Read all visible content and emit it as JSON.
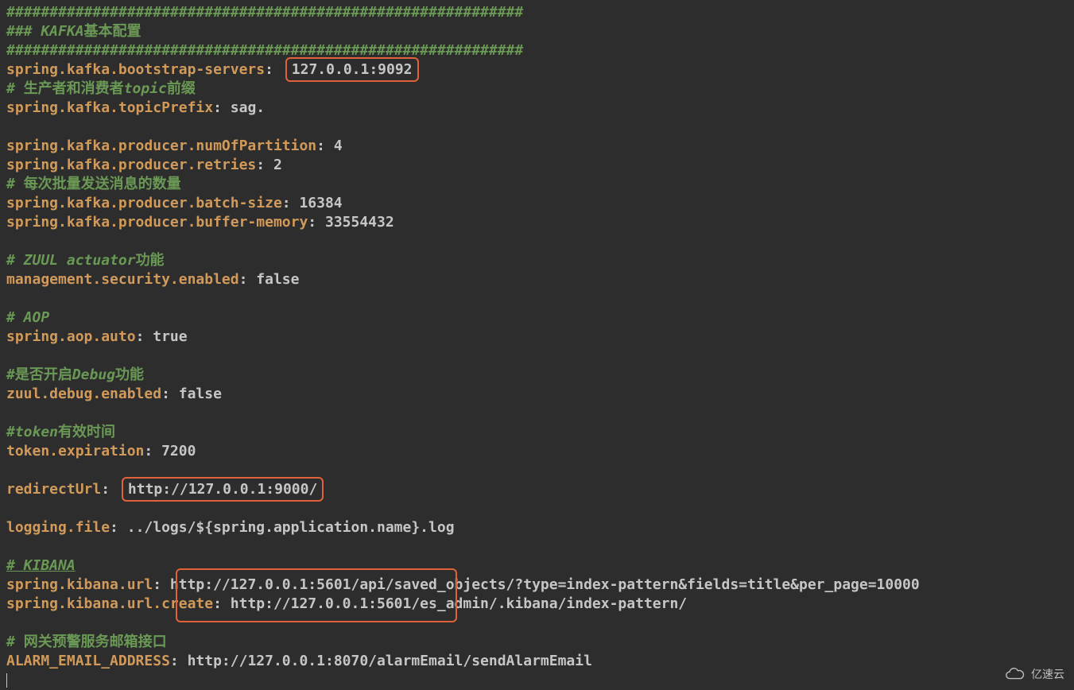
{
  "lines": {
    "l1": "############################################################",
    "l2_a": "### KAFKA",
    "l2_b": "基本配置",
    "l3": "############################################################",
    "k_bootstrap": "spring.kafka.bootstrap-servers",
    "v_bootstrap": "127.0.0.1:9092",
    "c_producer_consumer_a": "# ",
    "c_producer_consumer_b": "生产者和消费者",
    "c_producer_consumer_c": "topic",
    "c_producer_consumer_d": "前缀",
    "k_topicPrefix": "spring.kafka.topicPrefix",
    "v_topicPrefix": " sag.",
    "k_numPartition": "spring.kafka.producer.numOfPartition",
    "v_numPartition": " 4",
    "k_retries": "spring.kafka.producer.retries",
    "v_retries": " 2",
    "c_batch_a": "# ",
    "c_batch_b": "每次批量发送消息的数量",
    "k_batchSize": "spring.kafka.producer.batch-size",
    "v_batchSize": " 16384",
    "k_bufferMem": "spring.kafka.producer.buffer-memory",
    "v_bufferMem": " 33554432",
    "c_zuul_a": "# ZUUL actuator",
    "c_zuul_b": "功能",
    "k_mgmtSec": "management.security.enabled",
    "v_mgmtSec": " false",
    "c_aop": "# AOP",
    "k_aop": "spring.aop.auto",
    "v_aop": " true",
    "c_debug_a": "#",
    "c_debug_b": "是否开启",
    "c_debug_c": "Debug",
    "c_debug_d": "功能",
    "k_zuulDebug": "zuul.debug.enabled",
    "v_zuulDebug": " false",
    "c_token_a": "#token",
    "c_token_b": "有效时间",
    "k_tokenExp": "token.expiration",
    "v_tokenExp": " 7200",
    "k_redirect": "redirectUrl",
    "v_redirect": "http://127.0.0.1:9000/",
    "k_logFile": "logging.file",
    "v_logFile": " ../logs/${spring.application.name}.log",
    "c_kibana": "# KIBANA",
    "k_kibanaUrl": "spring.kibana.url",
    "v_kibanaUrl": " http://127.0.0.1:5601/api/saved_objects/?type=index-pattern&fields=title&per_page=10000",
    "k_kibanaCreate": "spring.kibana.url.create",
    "v_kibanaCreate": " http://127.0.0.1:5601/es_admin/.kibana/index-pattern/",
    "c_alarm_a": "# ",
    "c_alarm_b": "网关预警服务邮箱接口",
    "k_alarm": "ALARM_EMAIL_ADDRESS",
    "v_alarm": " http://127.0.0.1:8070/alarmEmail/sendAlarmEmail"
  },
  "watermark": "亿速云"
}
